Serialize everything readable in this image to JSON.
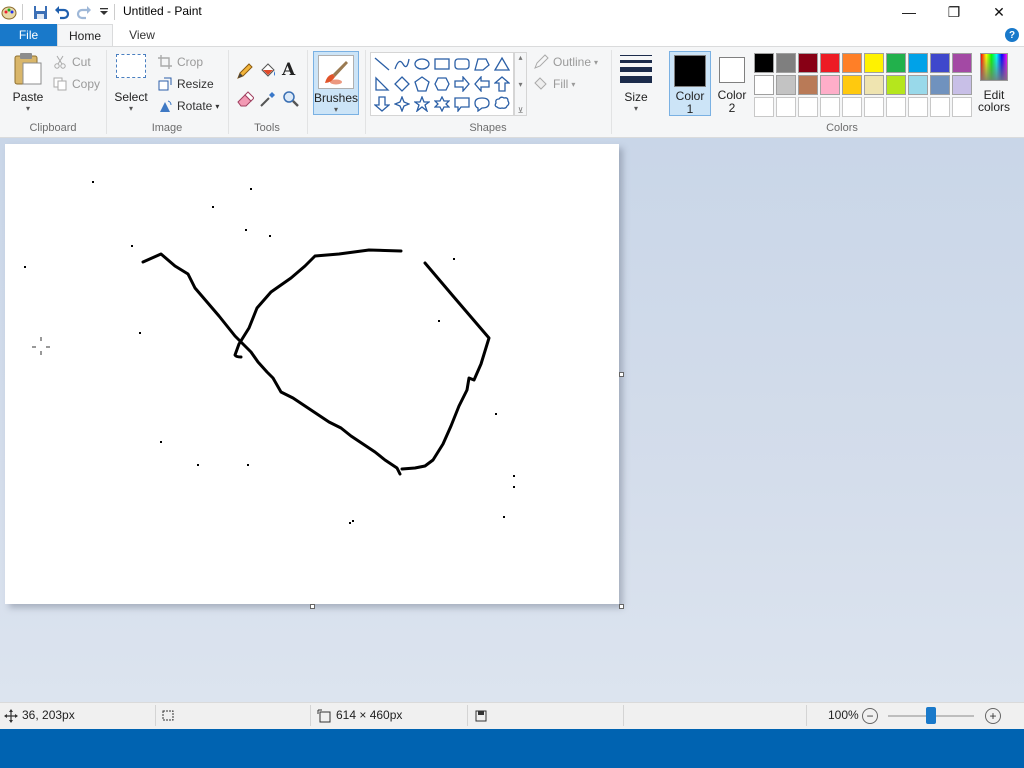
{
  "window": {
    "title": "Untitled - Paint",
    "minimize_glyph": "—",
    "maximize_glyph": "❐",
    "close_glyph": "✕"
  },
  "tabs": {
    "file": "File",
    "home": "Home",
    "view": "View",
    "help": "?"
  },
  "clipboard": {
    "label": "Clipboard",
    "paste": "Paste",
    "cut": "Cut",
    "copy": "Copy"
  },
  "image": {
    "label": "Image",
    "select": "Select",
    "crop": "Crop",
    "resize": "Resize",
    "rotate": "Rotate"
  },
  "tools": {
    "label": "Tools",
    "text_glyph": "A"
  },
  "brushes": {
    "label": "Brushes"
  },
  "shapes": {
    "label": "Shapes",
    "outline": "Outline",
    "fill": "Fill"
  },
  "size": {
    "label": "Size"
  },
  "color1": {
    "label_line1": "Color",
    "label_line2": "1",
    "value": "#000000"
  },
  "color2": {
    "label_line1": "Color",
    "label_line2": "2",
    "value": "#ffffff"
  },
  "colors": {
    "label": "Colors",
    "edit_line1": "Edit",
    "edit_line2": "colors",
    "row1": [
      "#000000",
      "#7f7f7f",
      "#880015",
      "#ed1c24",
      "#ff7f27",
      "#fff200",
      "#22b14c",
      "#00a2e8",
      "#3f48cc",
      "#a349a4"
    ],
    "row2": [
      "#ffffff",
      "#c3c3c3",
      "#b97a57",
      "#ffaec9",
      "#ffc90e",
      "#efe4b0",
      "#b5e61d",
      "#99d9ea",
      "#7092be",
      "#c8bfe7"
    ]
  },
  "status": {
    "cursor_pos": "36, 203px",
    "image_size": "614 × 460px",
    "zoom": "100%",
    "zoom_fraction": 0.5
  },
  "accent": "#1979ca"
}
